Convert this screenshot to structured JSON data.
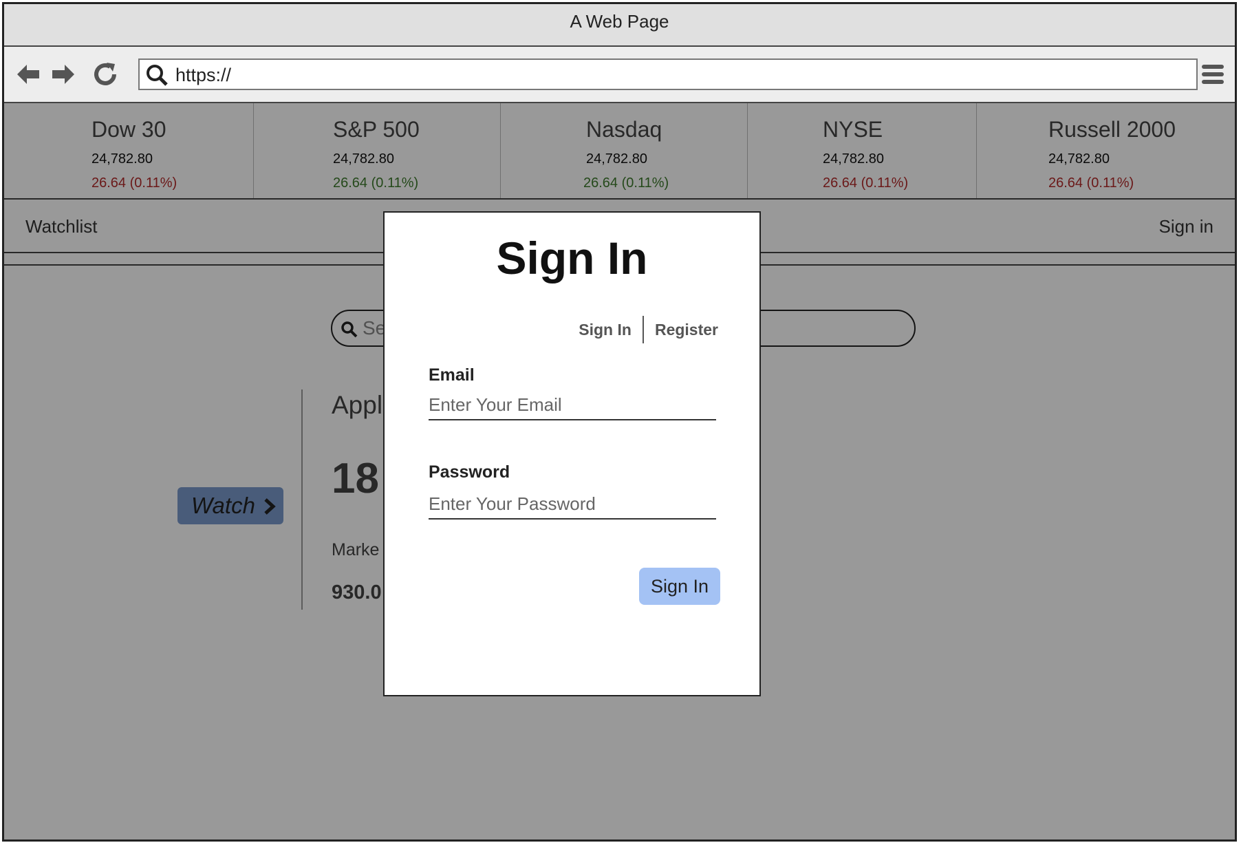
{
  "window": {
    "title": "A Web Page"
  },
  "browser": {
    "url": "https://"
  },
  "tickers": [
    {
      "name": "Dow 30",
      "value": "24,782.80",
      "change": "26.64 (0.11%)",
      "direction": "down"
    },
    {
      "name": "S&P 500",
      "value": "24,782.80",
      "change": "26.64 (0.11%)",
      "direction": "up"
    },
    {
      "name": "Nasdaq",
      "value": "24,782.80",
      "change": "26.64 (0.11%)",
      "direction": "up"
    },
    {
      "name": "NYSE",
      "value": "24,782.80",
      "change": "26.64 (0.11%)",
      "direction": "down"
    },
    {
      "name": "Russell 2000",
      "value": "24,782.80",
      "change": "26.64 (0.11%)",
      "direction": "down"
    }
  ],
  "nav": {
    "watchlist": "Watchlist",
    "signin": "Sign in"
  },
  "search": {
    "partial_text": "Se"
  },
  "stock": {
    "name_partial": "Appl",
    "price_partial": "18",
    "market_label_partial": "Marke",
    "market_value_partial": "930.0"
  },
  "watch_button": {
    "label": "Watch"
  },
  "modal": {
    "title": "Sign In",
    "tabs": {
      "signin": "Sign In",
      "register": "Register"
    },
    "email": {
      "label": "Email",
      "placeholder": "Enter Your Email"
    },
    "password": {
      "label": "Password",
      "placeholder": "Enter Your Password"
    },
    "submit": "Sign In"
  },
  "colors": {
    "down": "#b22a2a",
    "up": "#3d7a2c",
    "watch_button": "#7b9acb",
    "submit_button": "#a4c2f4"
  }
}
